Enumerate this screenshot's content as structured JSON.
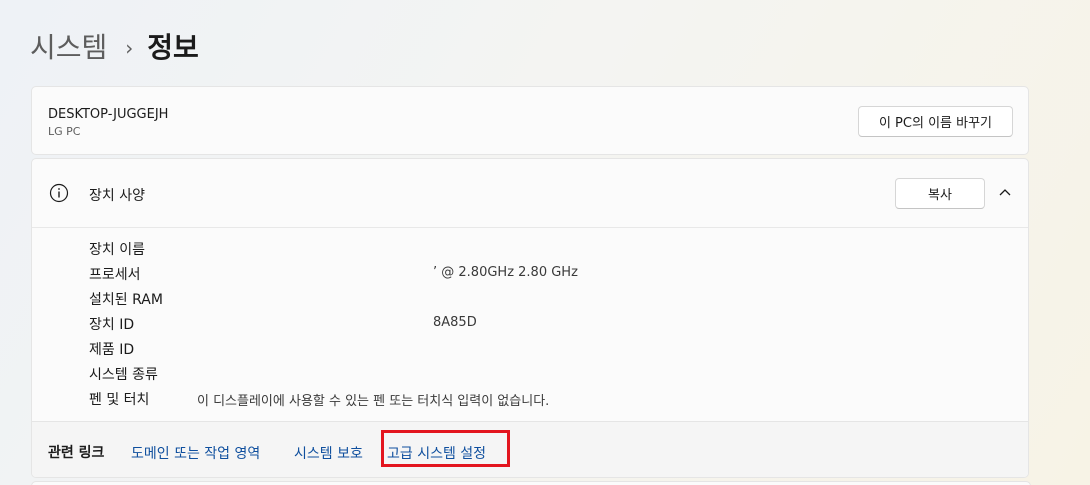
{
  "breadcrumb": {
    "parent": "시스템",
    "separator": "›",
    "current": "정보"
  },
  "pc_card": {
    "name": "DESKTOP-JUGGEJH",
    "model": "LG PC",
    "rename_button": "이 PC의 이름 바꾸기"
  },
  "device_specs": {
    "title": "장치 사양",
    "copy_button": "복사",
    "icon": "info-icon",
    "collapse_icon": "chevron-up-icon",
    "rows": [
      {
        "label": "장치 이름",
        "value": ""
      },
      {
        "label": "프로세서",
        "value": "’ @ 2.80GHz   2.80 GHz"
      },
      {
        "label": "설치된 RAM",
        "value": ""
      },
      {
        "label": "장치 ID",
        "value": "8A85D"
      },
      {
        "label": "제품 ID",
        "value": ""
      },
      {
        "label": "시스템 종류",
        "value": ""
      },
      {
        "label": "펜 및 터치",
        "value": "이 디스플레이에 사용할 수 있는 펜 또는 터치식 입력이 없습니다."
      }
    ]
  },
  "related_links": {
    "title": "관련 링크",
    "links": [
      "도메인 또는 작업 영역",
      "시스템 보호",
      "고급 시스템 설정"
    ],
    "highlight_color": "#e3151e"
  },
  "colors": {
    "link": "#0f4f9e",
    "card_background": "#fbfbfb"
  }
}
